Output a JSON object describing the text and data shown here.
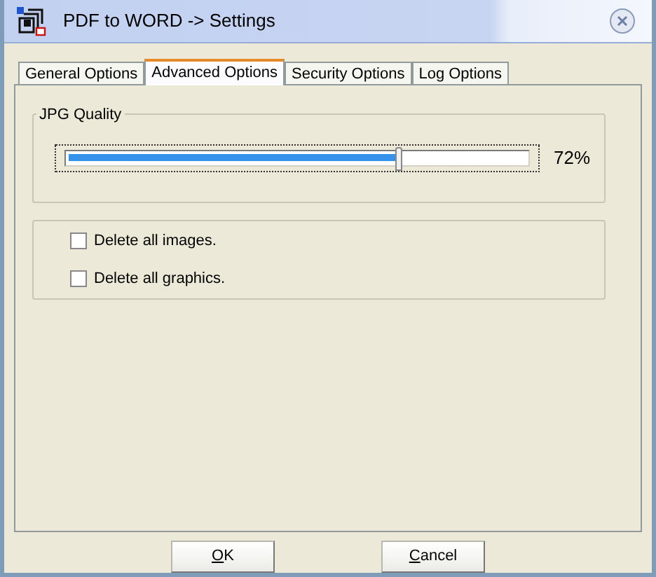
{
  "window": {
    "title": "PDF to WORD -> Settings"
  },
  "tabs": [
    {
      "label": "General Options",
      "selected": false
    },
    {
      "label": "Advanced Options",
      "selected": true
    },
    {
      "label": "Security Options",
      "selected": false
    },
    {
      "label": "Log Options",
      "selected": false
    }
  ],
  "jpg_quality": {
    "title": "JPG Quality",
    "level": 0.72,
    "reading": "72%"
  },
  "options": [
    {
      "label": "Delete all images.",
      "checked": false
    },
    {
      "label": "Delete all graphics.",
      "checked": false
    }
  ],
  "buttons": [
    {
      "label": "OK",
      "mnemonic_first": true
    },
    {
      "label": "Cancel",
      "mnemonic_first": true
    }
  ]
}
